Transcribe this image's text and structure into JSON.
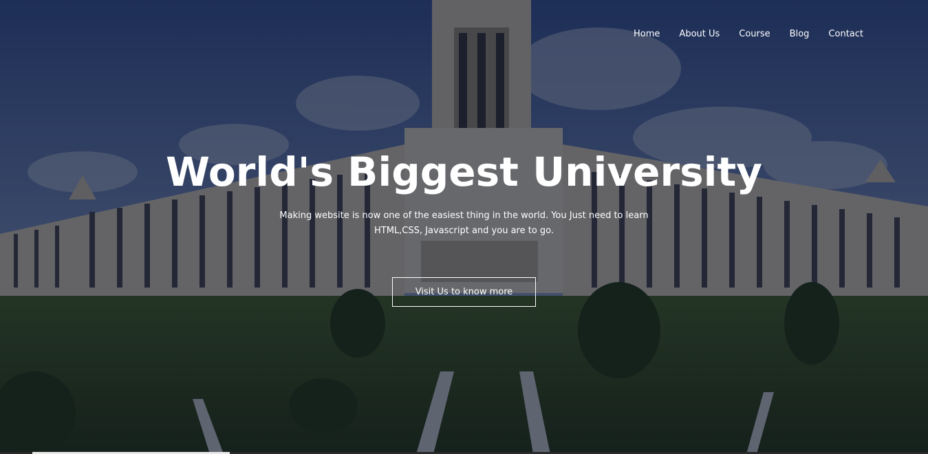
{
  "colors": {
    "overlay": "rgba(4,9,30,0.55)",
    "text": "#ffffff",
    "sky": "#5b78b4",
    "building": "#d8d2c0",
    "grass": "#3b5a24"
  },
  "nav": {
    "items": [
      {
        "label": "Home"
      },
      {
        "label": "About Us"
      },
      {
        "label": "Course"
      },
      {
        "label": "Blog"
      },
      {
        "label": "Contact"
      }
    ]
  },
  "hero": {
    "title": "World's Biggest University",
    "description": "Making website is now one of the easiest thing in the world. You Just need to learn HTML,CSS, Javascript and you are to go.",
    "button_label": "Visit Us to know more"
  }
}
